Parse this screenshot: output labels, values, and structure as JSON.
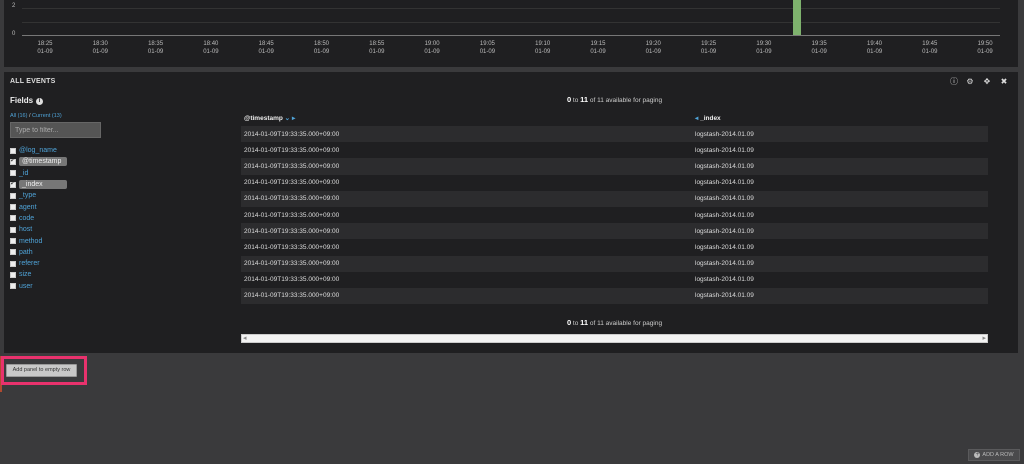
{
  "histogram": {
    "y_ticks": [
      "2",
      "0"
    ],
    "x_ticks": [
      {
        "time": "18:25",
        "date": "01-09"
      },
      {
        "time": "18:30",
        "date": "01-09"
      },
      {
        "time": "18:35",
        "date": "01-09"
      },
      {
        "time": "18:40",
        "date": "01-09"
      },
      {
        "time": "18:45",
        "date": "01-09"
      },
      {
        "time": "18:50",
        "date": "01-09"
      },
      {
        "time": "18:55",
        "date": "01-09"
      },
      {
        "time": "19:00",
        "date": "01-09"
      },
      {
        "time": "19:05",
        "date": "01-09"
      },
      {
        "time": "19:10",
        "date": "01-09"
      },
      {
        "time": "19:15",
        "date": "01-09"
      },
      {
        "time": "19:20",
        "date": "01-09"
      },
      {
        "time": "19:25",
        "date": "01-09"
      },
      {
        "time": "19:30",
        "date": "01-09"
      },
      {
        "time": "19:35",
        "date": "01-09"
      },
      {
        "time": "19:40",
        "date": "01-09"
      },
      {
        "time": "19:45",
        "date": "01-09"
      },
      {
        "time": "19:50",
        "date": "01-09"
      }
    ],
    "bar_color": "#7eb26d",
    "bars": [
      {
        "time": "19:33",
        "count": 11
      }
    ]
  },
  "panel": {
    "title": "ALL EVENTS",
    "icons": [
      "info-icon",
      "gear-icon",
      "move-icon",
      "close-icon"
    ]
  },
  "fields": {
    "title": "Fields",
    "tab_all": "All (16)",
    "tab_sep": "/",
    "tab_current": "Current (13)",
    "filter_placeholder": "Type to filter...",
    "items": [
      {
        "label": "@log_name",
        "checked": false
      },
      {
        "label": "@timestamp",
        "checked": true
      },
      {
        "label": "_id",
        "checked": false
      },
      {
        "label": "_index",
        "checked": true
      },
      {
        "label": "_type",
        "checked": false
      },
      {
        "label": "agent",
        "checked": false
      },
      {
        "label": "code",
        "checked": false
      },
      {
        "label": "host",
        "checked": false
      },
      {
        "label": "method",
        "checked": false
      },
      {
        "label": "path",
        "checked": false
      },
      {
        "label": "referer",
        "checked": false
      },
      {
        "label": "size",
        "checked": false
      },
      {
        "label": "user",
        "checked": false
      }
    ]
  },
  "paging": {
    "from": "0",
    "to_word": "to",
    "to": "11",
    "suffix": "of 11 available for paging"
  },
  "table": {
    "col1": "@timestamp",
    "col2": "_index",
    "rows": [
      [
        "2014-01-09T19:33:35.000+09:00",
        "logstash-2014.01.09"
      ],
      [
        "2014-01-09T19:33:35.000+09:00",
        "logstash-2014.01.09"
      ],
      [
        "2014-01-09T19:33:35.000+09:00",
        "logstash-2014.01.09"
      ],
      [
        "2014-01-09T19:33:35.000+09:00",
        "logstash-2014.01.09"
      ],
      [
        "2014-01-09T19:33:35.000+09:00",
        "logstash-2014.01.09"
      ],
      [
        "2014-01-09T19:33:35.000+09:00",
        "logstash-2014.01.09"
      ],
      [
        "2014-01-09T19:33:35.000+09:00",
        "logstash-2014.01.09"
      ],
      [
        "2014-01-09T19:33:35.000+09:00",
        "logstash-2014.01.09"
      ],
      [
        "2014-01-09T19:33:35.000+09:00",
        "logstash-2014.01.09"
      ],
      [
        "2014-01-09T19:33:35.000+09:00",
        "logstash-2014.01.09"
      ],
      [
        "2014-01-09T19:33:35.000+09:00",
        "logstash-2014.01.09"
      ]
    ]
  },
  "buttons": {
    "add_panel": "Add panel to empty row",
    "add_row": "ADD A ROW"
  }
}
